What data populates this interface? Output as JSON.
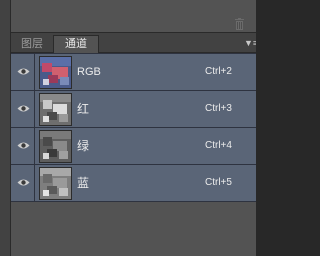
{
  "panel": {
    "tabs": [
      {
        "label": "图层",
        "active": false
      },
      {
        "label": "通道",
        "active": true
      }
    ],
    "menu_icon": "panel-menu-icon",
    "delete_icon": "trash-icon"
  },
  "channels": [
    {
      "name": "RGB",
      "shortcut": "Ctrl+2",
      "visible": true,
      "thumb": "rgb"
    },
    {
      "name": "红",
      "shortcut": "Ctrl+3",
      "visible": true,
      "thumb": "gray"
    },
    {
      "name": "绿",
      "shortcut": "Ctrl+4",
      "visible": true,
      "thumb": "gray"
    },
    {
      "name": "蓝",
      "shortcut": "Ctrl+5",
      "visible": true,
      "thumb": "gray"
    }
  ],
  "colors": {
    "panel_bg": "#535353",
    "selected_row": "#5a6577",
    "text": "#ececec"
  }
}
